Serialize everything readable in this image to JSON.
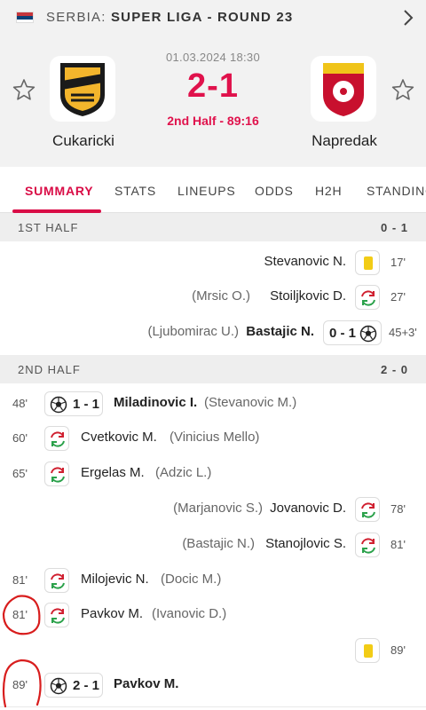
{
  "header": {
    "country": "SERBIA:",
    "competition": "SUPER LIGA - ROUND 23",
    "datetime": "01.03.2024 18:30",
    "score": "2-1",
    "status": "2nd Half - 89:16",
    "home_team": "Cukaricki",
    "away_team": "Napredak",
    "colors": {
      "accent": "#e0124c",
      "yellow_card": "#f2cc16"
    }
  },
  "tabs": [
    "SUMMARY",
    "STATS",
    "LINEUPS",
    "ODDS",
    "H2H",
    "STANDINGS"
  ],
  "first_half": {
    "label": "1ST HALF",
    "result": "0 - 1",
    "events": [
      {
        "time": "17'",
        "player": "Stevanovic N.",
        "icon": "yellow-card"
      },
      {
        "time": "27'",
        "player": "Stoiljkovic D.",
        "assist": "(Mrsic O.)",
        "icon": "substitution"
      },
      {
        "time": "45+3'",
        "player": "Bastajic N.",
        "assist": "(Ljubomirac U.)",
        "score": "0 - 1",
        "icon": "goal"
      }
    ]
  },
  "second_half": {
    "label": "2ND HALF",
    "result": "2 - 0",
    "events": [
      {
        "time": "48'",
        "player": "Miladinovic I.",
        "assist": "(Stevanovic M.)",
        "score": "1 - 1",
        "icon": "goal"
      },
      {
        "time": "60'",
        "player": "Cvetkovic M.",
        "assist": "(Vinicius Mello)",
        "icon": "substitution"
      },
      {
        "time": "65'",
        "player": "Ergelas M.",
        "assist": "(Adzic L.)",
        "icon": "substitution"
      },
      {
        "time": "78'",
        "player": "Jovanovic D.",
        "assist": "(Marjanovic S.)",
        "icon": "substitution"
      },
      {
        "time": "81'",
        "player": "Stanojlovic S.",
        "assist": "(Bastajic N.)",
        "icon": "substitution"
      },
      {
        "time": "81'",
        "player": "Milojevic N.",
        "assist": "(Docic M.)",
        "icon": "substitution"
      },
      {
        "time": "81'",
        "player": "Pavkov M.",
        "assist": "(Ivanovic D.)",
        "icon": "substitution"
      },
      {
        "time": "89'",
        "icon": "yellow-card"
      },
      {
        "time": "89'",
        "player": "Pavkov M.",
        "score": "2 - 1",
        "icon": "goal"
      }
    ]
  }
}
